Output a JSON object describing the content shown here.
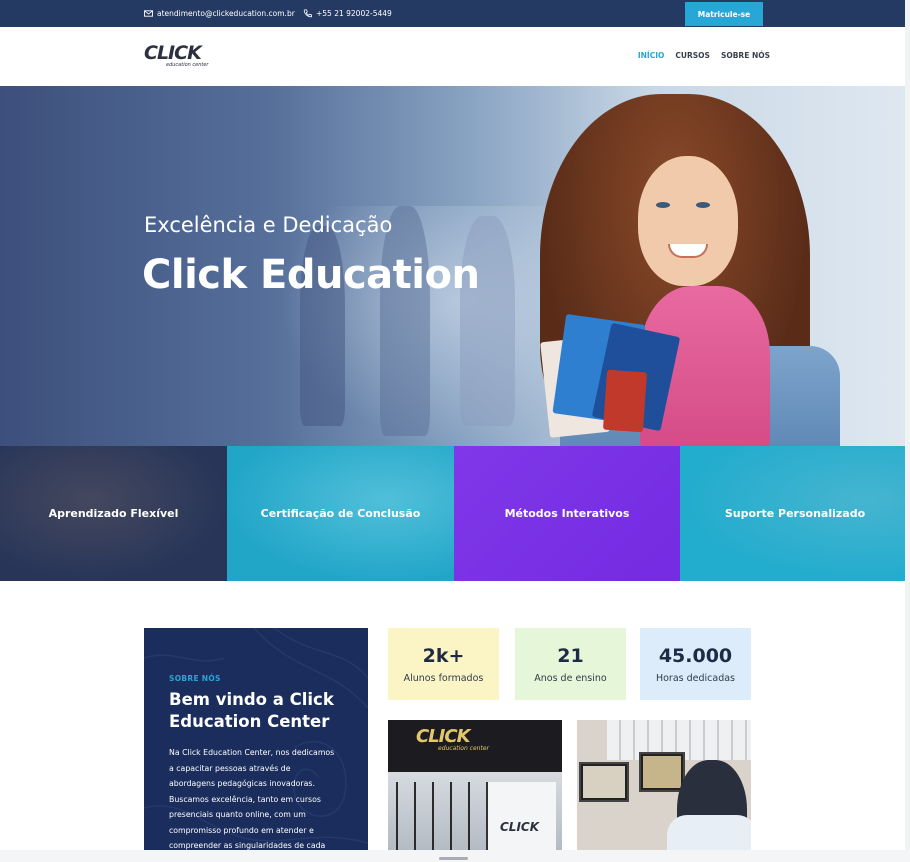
{
  "topbar": {
    "email": "atendimento@clickeducation.com.br",
    "phone": "+55 21 92002-5449",
    "enroll_label": "Matricule-se",
    "email_icon": "envelope-icon",
    "phone_icon": "phone-icon"
  },
  "header": {
    "logo_word": "CLICK",
    "logo_sub": "education center",
    "nav": [
      "INÍCIO",
      "CURSOS",
      "SOBRE NÓS"
    ]
  },
  "hero": {
    "subtitle": "Excelência e Dedicação",
    "title": "Click Education"
  },
  "features": [
    "Aprendizado Flexível",
    "Certificação de Conclusão",
    "Métodos Interativos",
    "Suporte Personalizado"
  ],
  "about": {
    "kicker": "SOBRE NÓS",
    "title": "Bem vindo a Click Education Center",
    "text": "Na Click Education Center, nos dedicamos a capacitar pessoas através de abordagens pedagógicas inovadoras. Buscamos excelência, tanto em cursos presenciais quanto online, com um compromisso profundo em atender e compreender as singularidades de cada"
  },
  "stats": [
    {
      "value": "2k+",
      "label": "Alunos formados"
    },
    {
      "value": "21",
      "label": "Anos de ensino"
    },
    {
      "value": "45.000",
      "label": "Horas dedicadas"
    }
  ],
  "photos": {
    "storefront_sign": "CLICK",
    "storefront_sign_sub": "education center",
    "door_logo": "CLICK"
  },
  "colors": {
    "navy": "#243a63",
    "accent": "#27a7d6",
    "purple": "#7a30e6",
    "about_bg": "#1a2d5c"
  }
}
